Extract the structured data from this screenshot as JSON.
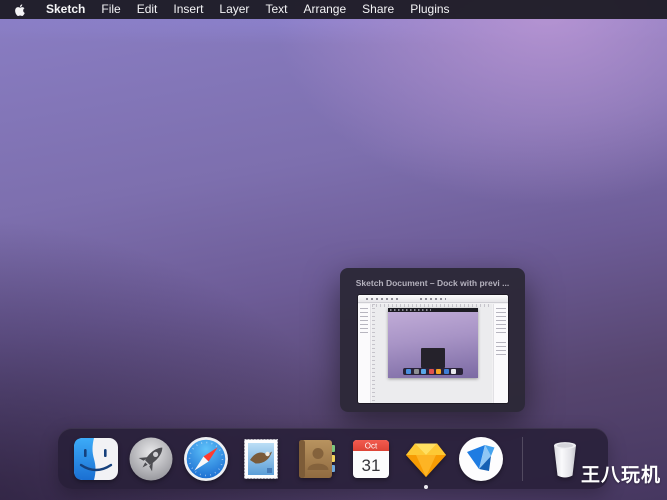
{
  "menu_bar": {
    "apple_icon": "apple-logo",
    "app_menu": "Sketch",
    "items": [
      "File",
      "Edit",
      "Insert",
      "Layer",
      "Text",
      "Arrange",
      "Share",
      "Plugins"
    ]
  },
  "popup": {
    "title": "Sketch Document – Dock with previ ...",
    "thumbnail": "sketch-document-window-preview"
  },
  "dock": {
    "apps": [
      "Finder",
      "Launchpad",
      "Safari",
      "Mail",
      "Contacts",
      "Calendar",
      "Sketch",
      "Origami-bird-app"
    ],
    "calendar": {
      "month": "Oct",
      "day": "31"
    },
    "running_app": "Sketch",
    "trash": "Trash"
  },
  "watermark": "王八玩机",
  "colors": {
    "menubar_bg": "#1e1c26",
    "dock_bg": "rgba(39,31,55,0.85)",
    "popup_bg": "#2c2838",
    "desktop_top_left": "#8a7ec4",
    "desktop_top_right": "#ba96d4",
    "desktop_bottom_left": "#372a4c",
    "desktop_bottom_right": "#5d4872",
    "finder_blue": "#2e95ef",
    "safari_blue": "#2a85e0",
    "sketch_orange": "#fdad00",
    "calendar_red": "#ec5044"
  }
}
